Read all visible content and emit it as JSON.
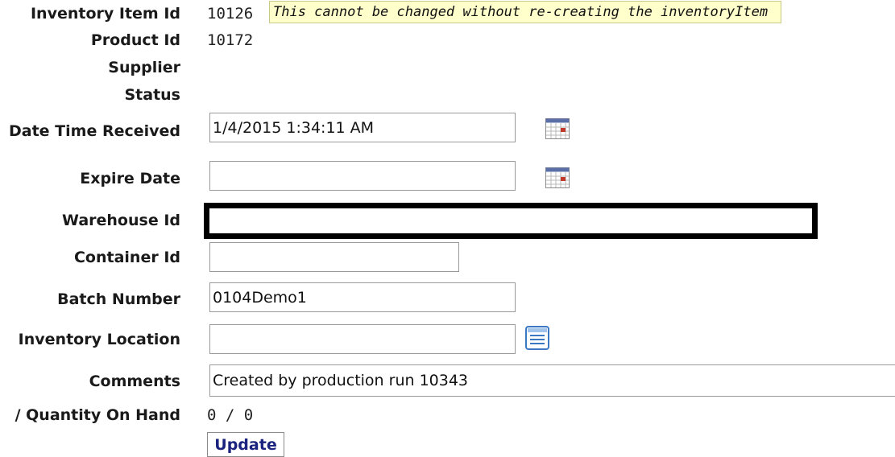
{
  "fields": {
    "inventory_item_id": {
      "label": "Inventory Item Id",
      "value": "10126"
    },
    "product_id": {
      "label": "Product Id",
      "value": "10172"
    },
    "supplier": {
      "label": "Supplier"
    },
    "status": {
      "label": "Status"
    },
    "date_time_received": {
      "label": "Date Time Received",
      "value": "1/4/2015 1:34:11 AM"
    },
    "expire_date": {
      "label": "Expire Date",
      "value": ""
    },
    "warehouse_id": {
      "label": "Warehouse Id",
      "value": ""
    },
    "container_id": {
      "label": "Container Id",
      "value": ""
    },
    "batch_number": {
      "label": "Batch Number",
      "value": "0104Demo1"
    },
    "inventory_location": {
      "label": "Inventory Location",
      "value": ""
    },
    "comments": {
      "label": "Comments",
      "value": "Created by production run 10343"
    },
    "quantity": {
      "label": "/ Quantity On Hand",
      "value": "0 / 0"
    }
  },
  "tooltip": "This cannot be changed without re-creating the inventoryItem",
  "update_button": "Update",
  "icons": {
    "calendar": "calendar-icon",
    "lookup": "lookup-list-icon"
  }
}
